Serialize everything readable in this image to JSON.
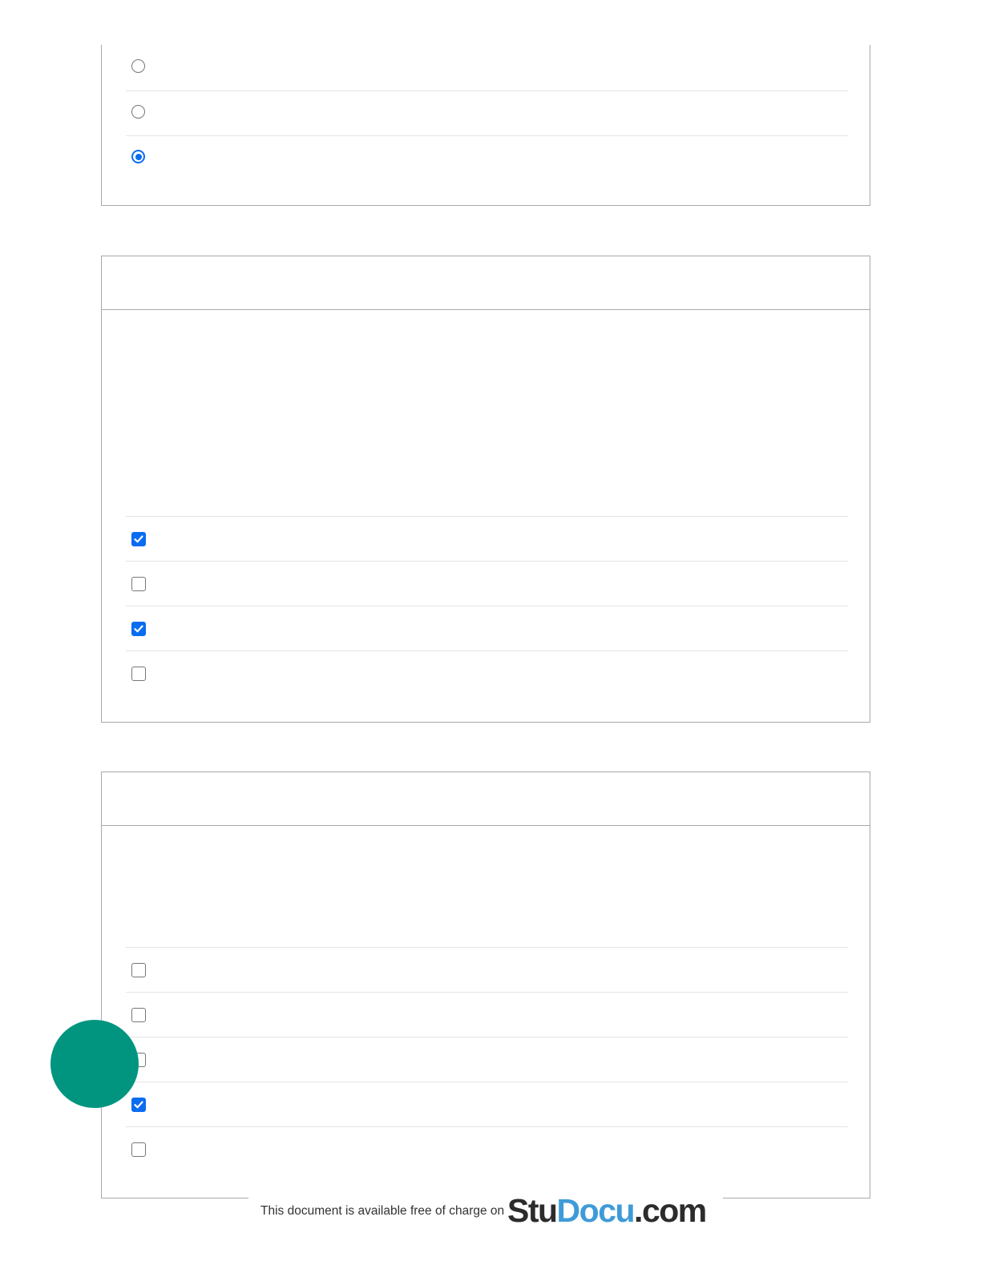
{
  "question_1": {
    "options": [
      {
        "selected": false
      },
      {
        "selected": false
      },
      {
        "selected": true
      }
    ]
  },
  "question_2": {
    "options": [
      {
        "checked": true
      },
      {
        "checked": false
      },
      {
        "checked": true
      },
      {
        "checked": false
      }
    ]
  },
  "question_3": {
    "options": [
      {
        "checked": false
      },
      {
        "checked": false
      },
      {
        "checked": false
      },
      {
        "checked": true
      },
      {
        "checked": false
      }
    ]
  },
  "footer": {
    "notice": "This document is available free of charge on",
    "logo_part1": "Stu",
    "logo_part2": "Docu",
    "logo_part3": ".com"
  },
  "colors": {
    "accent": "#0a6df0",
    "fab": "#019580",
    "logo_blue": "#3f9bd8",
    "logo_dark": "#2c2c2c"
  }
}
